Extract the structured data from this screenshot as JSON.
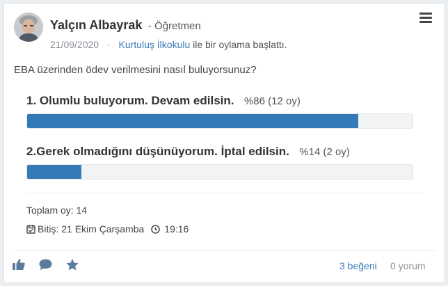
{
  "post": {
    "author_name": "Yalçın Albayrak",
    "author_role": "- Öğretmen",
    "date": "21/09/2020",
    "separator": "·",
    "school": "Kurtuluş İlkokulu",
    "action": "ile bir oylama başlattı."
  },
  "poll": {
    "question": "EBA üzerinden ödev verilmesini nasıl buluyorsunuz?",
    "options": [
      {
        "label": "1. Olumlu buluyorum. Devam edilsin.",
        "stat": "%86 (12 oy)",
        "percent": 86
      },
      {
        "label": "2.Gerek olmadığını düşünüyorum. İptal edilsin.",
        "stat": "%14 (2 oy)",
        "percent": 14
      }
    ],
    "total": "Toplam oy: 14",
    "end_date": "Bitiş: 21 Ekim Çarşamba",
    "end_time": "19:16"
  },
  "footer": {
    "likes": "3 beğeni",
    "comments": "0 yorum"
  },
  "colors": {
    "bar_fill": "#337ab7",
    "link": "#3a7ab8"
  },
  "icons": [
    "menu-icon",
    "calendar-icon",
    "clock-icon",
    "like-icon",
    "comment-icon",
    "star-icon"
  ]
}
